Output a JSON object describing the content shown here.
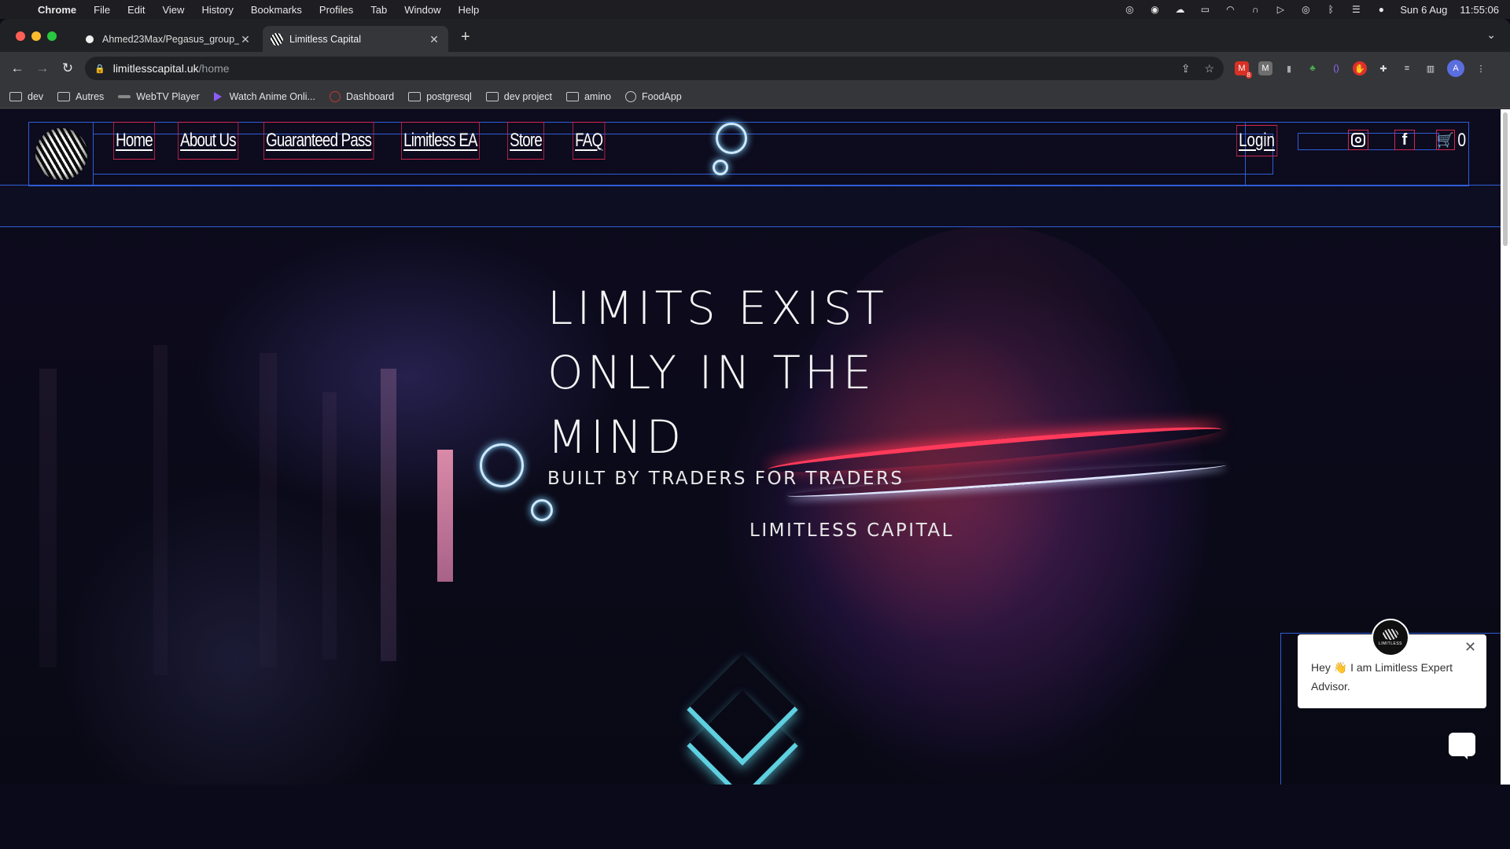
{
  "menubar": {
    "app": "Chrome",
    "menus": [
      "File",
      "Edit",
      "View",
      "History",
      "Bookmarks",
      "Profiles",
      "Tab",
      "Window",
      "Help"
    ],
    "date": "Sun 6 Aug",
    "time": "11:55:06"
  },
  "tabs": [
    {
      "label": "Ahmed23Max/Pegasus_group_",
      "icon": "github-icon"
    },
    {
      "label": "Limitless Capital",
      "icon": "limitless-favicon"
    }
  ],
  "toolbar": {
    "url_host": "limitlesscapital.uk",
    "url_path": "/home",
    "avatar_letter": "A",
    "gmail_badge": "8"
  },
  "bookmarks": [
    {
      "label": "dev",
      "icon": "folder-icon"
    },
    {
      "label": "Autres",
      "icon": "folder-icon"
    },
    {
      "label": "WebTV Player",
      "icon": "webtv-icon"
    },
    {
      "label": "Watch Anime Onli...",
      "icon": "play-icon"
    },
    {
      "label": "Dashboard",
      "icon": "dashboard-icon"
    },
    {
      "label": "postgresql",
      "icon": "folder-icon"
    },
    {
      "label": "dev project",
      "icon": "folder-icon"
    },
    {
      "label": "amino",
      "icon": "folder-icon"
    },
    {
      "label": "FoodApp",
      "icon": "globe-icon"
    }
  ],
  "site": {
    "nav": [
      "Home",
      "About Us",
      "Guaranteed Pass",
      "Limitless EA",
      "Store",
      "FAQ"
    ],
    "login": "Login",
    "cart_count": "0",
    "hero_lines": [
      "LIMITS EXIST",
      "ONLY IN THE",
      "MIND"
    ],
    "hero_sub": "BUILT BY TRADERS FOR TRADERS",
    "hero_brand": "LIMITLESS CAPITAL"
  },
  "chat": {
    "message": "Hey 👋 I am Limitless Expert Advisor.",
    "avatar_label": "LIMITLESS"
  }
}
